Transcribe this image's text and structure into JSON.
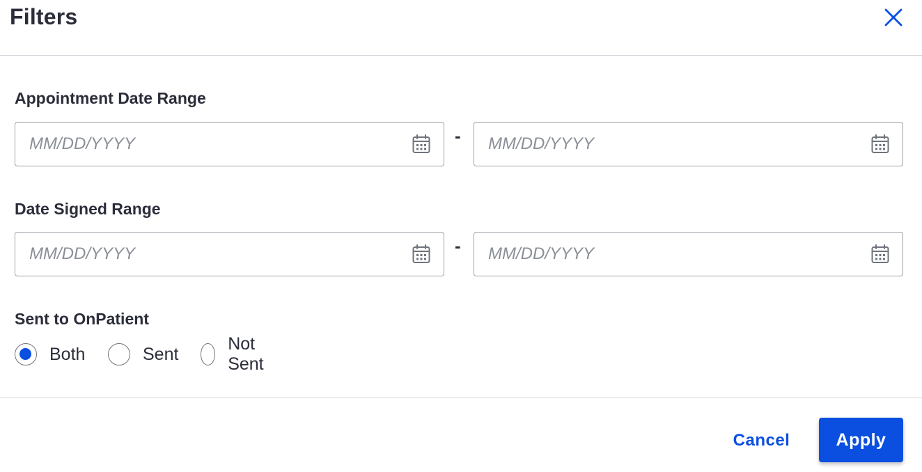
{
  "header": {
    "title": "Filters",
    "close_icon": "close-icon"
  },
  "appointment_date_range": {
    "label": "Appointment Date Range",
    "from_placeholder": "MM/DD/YYYY",
    "from_value": "",
    "to_placeholder": "MM/DD/YYYY",
    "to_value": "",
    "separator": "-",
    "icon": "calendar-icon"
  },
  "date_signed_range": {
    "label": "Date Signed Range",
    "from_placeholder": "MM/DD/YYYY",
    "from_value": "",
    "to_placeholder": "MM/DD/YYYY",
    "to_value": "",
    "separator": "-",
    "icon": "calendar-icon"
  },
  "sent_to_onpatient": {
    "label": "Sent to OnPatient",
    "options": [
      {
        "label": "Both",
        "checked": true
      },
      {
        "label": "Sent",
        "checked": false
      },
      {
        "label": "Not Sent",
        "checked": false
      }
    ]
  },
  "footer": {
    "cancel_label": "Cancel",
    "apply_label": "Apply"
  },
  "colors": {
    "accent": "#0b4fe0",
    "text": "#2b2d3a",
    "border": "#9aa0a8",
    "placeholder": "#8b8f97",
    "divider": "#d4d6dc"
  }
}
